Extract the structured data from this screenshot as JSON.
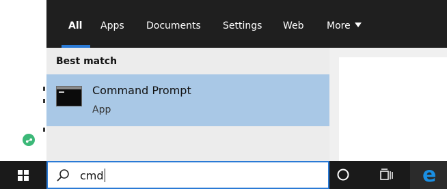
{
  "tabs": [
    {
      "label": "All"
    },
    {
      "label": "Apps"
    },
    {
      "label": "Documents"
    },
    {
      "label": "Settings"
    },
    {
      "label": "Web"
    },
    {
      "label": "More"
    }
  ],
  "section_heading": "Best match",
  "best_match": {
    "title": "Command Prompt",
    "subtitle": "App",
    "icon": "command-prompt-icon"
  },
  "search": {
    "value": "cmd",
    "icon": "search-icon"
  },
  "taskbar": {
    "start_icon": "windows-logo-icon",
    "cortana_icon": "cortana-circle-icon",
    "taskview_icon": "task-view-icon",
    "pinned_app_icon": "edge-icon"
  },
  "colors": {
    "tab_bar": "#1f1f1f",
    "accent": "#2a7ad5",
    "selected_result": "#a9c8e6",
    "taskbar": "#1a1a1a"
  }
}
